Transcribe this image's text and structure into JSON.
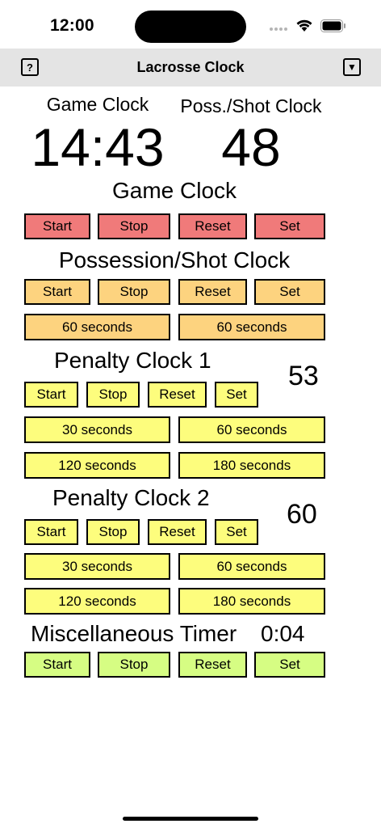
{
  "status": {
    "time": "12:00"
  },
  "nav": {
    "title": "Lacrosse Clock",
    "help_glyph": "?",
    "menu_glyph": "▼"
  },
  "colors": {
    "game": "#f07a7a",
    "shot": "#fdd37f",
    "penalty": "#fdfd7d",
    "misc": "#d6fd83",
    "navbar": "#e4e4e4"
  },
  "clocks": {
    "game_label": "Game Clock",
    "game_value": "14:43",
    "shot_label": "Poss./Shot Clock",
    "shot_value": "48"
  },
  "game_section": {
    "title": "Game Clock",
    "start": "Start",
    "stop": "Stop",
    "reset": "Reset",
    "set": "Set"
  },
  "shot_section": {
    "title": "Possession/Shot Clock",
    "start": "Start",
    "stop": "Stop",
    "reset": "Reset",
    "set": "Set",
    "preset_a": "60 seconds",
    "preset_b": "60 seconds"
  },
  "penalty1": {
    "title": "Penalty Clock 1",
    "value": "53",
    "start": "Start",
    "stop": "Stop",
    "reset": "Reset",
    "set": "Set",
    "p30": "30 seconds",
    "p60": "60 seconds",
    "p120": "120 seconds",
    "p180": "180 seconds"
  },
  "penalty2": {
    "title": "Penalty Clock 2",
    "value": "60",
    "start": "Start",
    "stop": "Stop",
    "reset": "Reset",
    "set": "Set",
    "p30": "30 seconds",
    "p60": "60 seconds",
    "p120": "120 seconds",
    "p180": "180 seconds"
  },
  "misc": {
    "title": "Miscellaneous Timer",
    "value": "0:04",
    "start": "Start",
    "stop": "Stop",
    "reset": "Reset",
    "set": "Set"
  }
}
